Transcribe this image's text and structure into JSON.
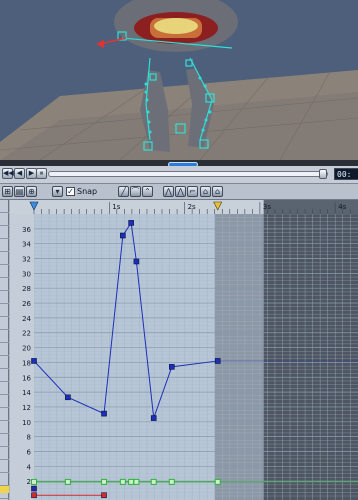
{
  "viewport": {
    "description_icons": [
      "character-rig-icon"
    ]
  },
  "transport": {
    "buttons": [
      "◀◀",
      "◀",
      "▶",
      "⏸",
      "▶▶"
    ],
    "time_display": "00:"
  },
  "toolbar": {
    "snap_label": "Snap",
    "snap_checked": true,
    "snap_check_glyph": "✓"
  },
  "timeline": {
    "marks": [
      "1s",
      "2s",
      "3s",
      "4s"
    ]
  },
  "chart_data": {
    "type": "line",
    "x_unit": "s",
    "xlim": [
      0,
      4.27
    ],
    "ylim": [
      0,
      38
    ],
    "y_ticks": [
      2,
      4,
      6,
      8,
      10,
      12,
      14,
      16,
      18,
      20,
      22,
      24,
      26,
      28,
      30,
      32,
      34,
      36
    ],
    "active_end": 2.4,
    "series": [
      {
        "color": "#1c2fb8",
        "points": [
          {
            "x": 0.0,
            "y": 18.2
          },
          {
            "x": 0.45,
            "y": 13.3
          },
          {
            "x": 0.93,
            "y": 11.1
          },
          {
            "x": 1.18,
            "y": 35.1
          },
          {
            "x": 1.29,
            "y": 36.8
          },
          {
            "x": 1.36,
            "y": 31.6
          },
          {
            "x": 1.59,
            "y": 10.5
          },
          {
            "x": 1.83,
            "y": 17.4
          },
          {
            "x": 2.44,
            "y": 18.2
          }
        ]
      },
      {
        "color": "#2fb33a",
        "points": [
          {
            "x": 0.0,
            "y": 1.9
          },
          {
            "x": 0.45,
            "y": 1.9
          },
          {
            "x": 0.93,
            "y": 1.9
          },
          {
            "x": 1.18,
            "y": 1.9
          },
          {
            "x": 1.29,
            "y": 1.9
          },
          {
            "x": 1.36,
            "y": 1.9
          },
          {
            "x": 1.59,
            "y": 1.9
          },
          {
            "x": 1.83,
            "y": 1.9
          },
          {
            "x": 2.44,
            "y": 1.9
          }
        ]
      },
      {
        "color": "#d42b2b",
        "points": [
          {
            "x": 0.0,
            "y": 0.1
          },
          {
            "x": 0.93,
            "y": 0.1
          }
        ]
      },
      {
        "color": "#2a2aa0",
        "points": [
          {
            "x": 0.0,
            "y": 1.0
          }
        ]
      }
    ]
  }
}
